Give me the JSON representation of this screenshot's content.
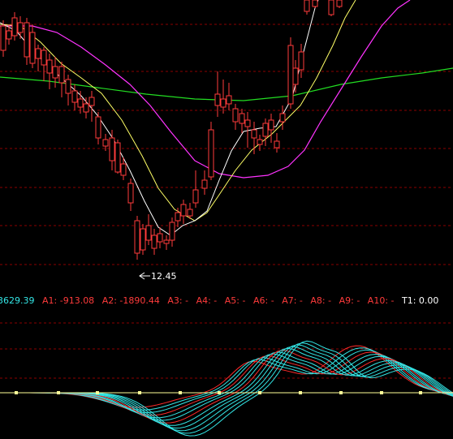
{
  "colors": {
    "background": "#000000",
    "grid": "#8b0000",
    "candle_up": "#ff3b3b",
    "candle_down": "#00e5ff",
    "ma_white": "#ffffff",
    "ma_yellow": "#ffff66",
    "ma_magenta": "#ff33ff",
    "ma_green": "#22dd22",
    "osc_cyan": "#33e6e6",
    "osc_red": "#ff2a2a",
    "osc_zero": "#ffff99",
    "text_cyan": "#33e6e6",
    "text_red": "#ff3b3b",
    "text_white": "#ffffff",
    "text_yellow": "#ffff66"
  },
  "main_panel": {
    "low_marker_label": "12.45"
  },
  "indicator_bar": {
    "items": [
      {
        "text": "3629.39",
        "color": "cyan"
      },
      {
        "text": "A1: -913.08",
        "color": "red"
      },
      {
        "text": "A2: -1890.44",
        "color": "red"
      },
      {
        "text": "A3: -",
        "color": "red"
      },
      {
        "text": "A4: -",
        "color": "red"
      },
      {
        "text": "A5: -",
        "color": "red"
      },
      {
        "text": "A6: -",
        "color": "red"
      },
      {
        "text": "A7: -",
        "color": "red"
      },
      {
        "text": "A8: -",
        "color": "red"
      },
      {
        "text": "A9: -",
        "color": "red"
      },
      {
        "text": "A10: -",
        "color": "red"
      },
      {
        "text": "T1: 0.00",
        "color": "white"
      }
    ]
  }
}
